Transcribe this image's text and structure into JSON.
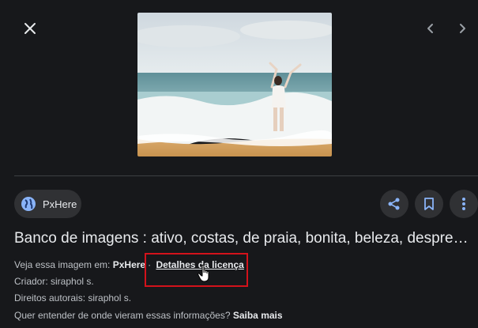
{
  "viewer": {
    "close_icon": "close-icon",
    "prev_icon": "chevron-left-icon",
    "next_icon": "chevron-right-icon"
  },
  "image": {
    "subject": "woman with raised arms on beach"
  },
  "source": {
    "name": "PxHere",
    "icon": "globe-icon"
  },
  "actions": {
    "share_icon": "share-icon",
    "save_icon": "bookmark-icon",
    "more_icon": "more-vert-icon"
  },
  "title": "Banco de imagens : ativo, costas, de praia, bonita, beleza, despre…",
  "details": {
    "view_prefix": "Veja essa imagem em:",
    "view_site": "PxHere",
    "license_link": "Detalhes da licença",
    "creator": "Criador: siraphol s.",
    "rights": "Direitos autorais: siraphol s.",
    "question": "Quer entender de onde vieram essas informações?",
    "learn_more": "Saiba mais"
  },
  "colors": {
    "background": "#17181b",
    "chip": "#303134",
    "highlight": "#d3121b"
  }
}
